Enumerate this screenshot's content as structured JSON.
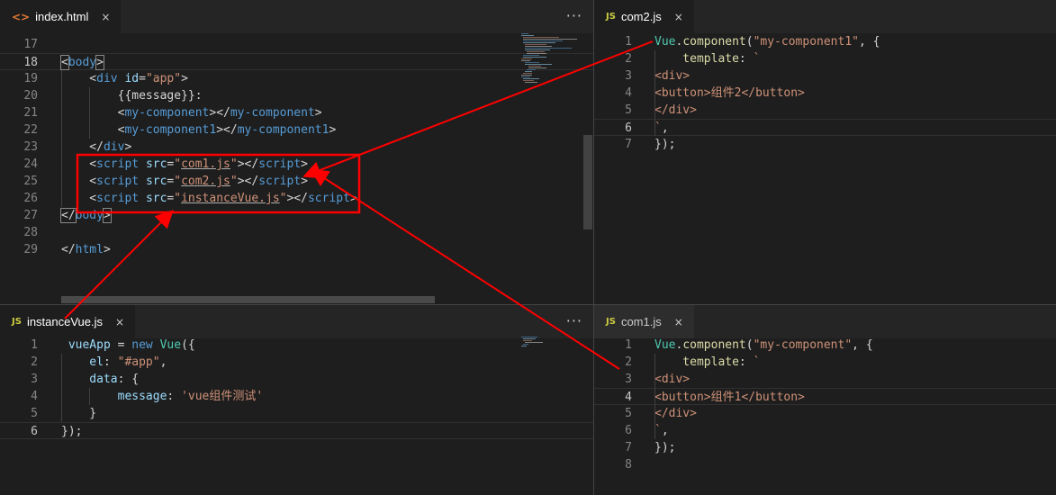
{
  "colors": {
    "annotation": "#ff0000",
    "editor_bg": "#1e1e1e",
    "tabbar_bg": "#252526"
  },
  "panes": {
    "index_html": {
      "tab": {
        "icon": "<>",
        "icon_name": "html-file-icon",
        "title": "index.html",
        "close": "×"
      },
      "more": "···",
      "lines": [
        {
          "n": "17",
          "tokens": []
        },
        {
          "n": "18",
          "tokens": [
            [
              "t-pun bracket",
              "<"
            ],
            [
              "t-tag",
              "body"
            ],
            [
              "t-pun bracket",
              ">"
            ]
          ]
        },
        {
          "n": "19",
          "tokens": [
            [
              "t-pun",
              "    <"
            ],
            [
              "t-tag",
              "div"
            ],
            [
              "t-pun",
              " "
            ],
            [
              "t-attr",
              "id"
            ],
            [
              "t-pun",
              "="
            ],
            [
              "t-str",
              "\"app\""
            ],
            [
              "t-pun",
              ">"
            ]
          ]
        },
        {
          "n": "20",
          "tokens": [
            [
              "t-text",
              "        {{message}}:"
            ]
          ]
        },
        {
          "n": "21",
          "tokens": [
            [
              "t-pun",
              "        <"
            ],
            [
              "t-tag",
              "my-component"
            ],
            [
              "t-pun",
              "></"
            ],
            [
              "t-tag",
              "my-component"
            ],
            [
              "t-pun",
              ">"
            ]
          ]
        },
        {
          "n": "22",
          "tokens": [
            [
              "t-pun",
              "        <"
            ],
            [
              "t-tag",
              "my-component1"
            ],
            [
              "t-pun",
              "></"
            ],
            [
              "t-tag",
              "my-component1"
            ],
            [
              "t-pun",
              ">"
            ]
          ]
        },
        {
          "n": "23",
          "tokens": [
            [
              "t-pun",
              "    </"
            ],
            [
              "t-tag",
              "div"
            ],
            [
              "t-pun",
              ">"
            ]
          ]
        },
        {
          "n": "24",
          "tokens": [
            [
              "t-pun",
              "    <"
            ],
            [
              "t-tag",
              "script"
            ],
            [
              "t-pun",
              " "
            ],
            [
              "t-attr",
              "src"
            ],
            [
              "t-pun",
              "="
            ],
            [
              "t-str",
              "\""
            ],
            [
              "t-str u",
              "com1.js"
            ],
            [
              "t-str",
              "\""
            ],
            [
              "t-pun",
              "></"
            ],
            [
              "t-tag",
              "script"
            ],
            [
              "t-pun",
              ">"
            ]
          ]
        },
        {
          "n": "25",
          "tokens": [
            [
              "t-pun",
              "    <"
            ],
            [
              "t-tag",
              "script"
            ],
            [
              "t-pun",
              " "
            ],
            [
              "t-attr",
              "src"
            ],
            [
              "t-pun",
              "="
            ],
            [
              "t-str",
              "\""
            ],
            [
              "t-str u",
              "com2.js"
            ],
            [
              "t-str",
              "\""
            ],
            [
              "t-pun",
              "></"
            ],
            [
              "t-tag",
              "script"
            ],
            [
              "t-pun",
              ">"
            ]
          ]
        },
        {
          "n": "26",
          "tokens": [
            [
              "t-pun",
              "    <"
            ],
            [
              "t-tag",
              "script"
            ],
            [
              "t-pun",
              " "
            ],
            [
              "t-attr",
              "src"
            ],
            [
              "t-pun",
              "="
            ],
            [
              "t-str",
              "\""
            ],
            [
              "t-str u",
              "instanceVue.js"
            ],
            [
              "t-str",
              "\""
            ],
            [
              "t-pun",
              "></"
            ],
            [
              "t-tag",
              "script"
            ],
            [
              "t-pun",
              ">"
            ]
          ]
        },
        {
          "n": "27",
          "tokens": [
            [
              "t-pun bracket",
              "</"
            ],
            [
              "t-tag",
              "body"
            ],
            [
              "t-pun bracket",
              ">"
            ]
          ]
        },
        {
          "n": "28",
          "tokens": []
        },
        {
          "n": "29",
          "tokens": [
            [
              "t-pun",
              "</"
            ],
            [
              "t-tag",
              "html"
            ],
            [
              "t-pun",
              ">"
            ]
          ]
        }
      ]
    },
    "com2_js": {
      "tab": {
        "icon": "JS",
        "icon_name": "js-file-icon",
        "title": "com2.js",
        "close": "×"
      },
      "lines": [
        {
          "n": "1",
          "tokens": [
            [
              "t-cls",
              "Vue"
            ],
            [
              "t-pun",
              "."
            ],
            [
              "t-fn",
              "component"
            ],
            [
              "t-pun",
              "("
            ],
            [
              "t-str",
              "\"my-component1\""
            ],
            [
              "t-pun",
              ", {"
            ]
          ]
        },
        {
          "n": "2",
          "tokens": [
            [
              "t-fn",
              "    template"
            ],
            [
              "t-pun",
              ": "
            ],
            [
              "t-str",
              "`"
            ]
          ]
        },
        {
          "n": "3",
          "tokens": [
            [
              "t-str",
              "<div>"
            ]
          ]
        },
        {
          "n": "4",
          "tokens": [
            [
              "t-str",
              "<button>组件2</button>"
            ]
          ]
        },
        {
          "n": "5",
          "tokens": [
            [
              "t-str",
              "</div>"
            ]
          ]
        },
        {
          "n": "6",
          "tokens": [
            [
              "t-str",
              "`"
            ],
            [
              "t-pun",
              ","
            ]
          ]
        },
        {
          "n": "7",
          "tokens": [
            [
              "t-pun",
              "});"
            ]
          ]
        }
      ]
    },
    "instanceVue_js": {
      "tab": {
        "icon": "JS",
        "icon_name": "js-file-icon",
        "title": "instanceVue.js",
        "close": "×"
      },
      "more": "···",
      "lines": [
        {
          "n": "1",
          "tokens": [
            [
              "t-prop",
              " vueApp"
            ],
            [
              "t-pun",
              " = "
            ],
            [
              "t-kw",
              "new"
            ],
            [
              "t-pun",
              " "
            ],
            [
              "t-cls",
              "Vue"
            ],
            [
              "t-pun",
              "({"
            ]
          ]
        },
        {
          "n": "2",
          "tokens": [
            [
              "t-prop",
              "    el"
            ],
            [
              "t-pun",
              ": "
            ],
            [
              "t-str",
              "\"#app\""
            ],
            [
              "t-pun",
              ","
            ]
          ]
        },
        {
          "n": "3",
          "tokens": [
            [
              "t-prop",
              "    data"
            ],
            [
              "t-pun",
              ": {"
            ]
          ]
        },
        {
          "n": "4",
          "tokens": [
            [
              "t-prop",
              "        message"
            ],
            [
              "t-pun",
              ": "
            ],
            [
              "t-str",
              "'vue组件测试'"
            ]
          ]
        },
        {
          "n": "5",
          "tokens": [
            [
              "t-pun",
              "    }"
            ]
          ]
        },
        {
          "n": "6",
          "tokens": [
            [
              "t-pun",
              "});"
            ]
          ]
        }
      ]
    },
    "com1_js": {
      "tab": {
        "icon": "JS",
        "icon_name": "js-file-icon",
        "title": "com1.js",
        "close": "×"
      },
      "lines": [
        {
          "n": "1",
          "tokens": [
            [
              "t-cls",
              "Vue"
            ],
            [
              "t-pun",
              "."
            ],
            [
              "t-fn",
              "component"
            ],
            [
              "t-pun",
              "("
            ],
            [
              "t-str",
              "\"my-component\""
            ],
            [
              "t-pun",
              ", {"
            ]
          ]
        },
        {
          "n": "2",
          "tokens": [
            [
              "t-fn",
              "    template"
            ],
            [
              "t-pun",
              ": "
            ],
            [
              "t-str",
              "`"
            ]
          ]
        },
        {
          "n": "3",
          "tokens": [
            [
              "t-str",
              "<div>"
            ]
          ]
        },
        {
          "n": "4",
          "tokens": [
            [
              "t-str",
              "<button>组件1</button>"
            ]
          ]
        },
        {
          "n": "5",
          "tokens": [
            [
              "t-str",
              "</div>"
            ]
          ]
        },
        {
          "n": "6",
          "tokens": [
            [
              "t-str",
              "`"
            ],
            [
              "t-pun",
              ","
            ]
          ]
        },
        {
          "n": "7",
          "tokens": [
            [
              "t-pun",
              "});"
            ]
          ]
        },
        {
          "n": "8",
          "tokens": []
        }
      ]
    }
  }
}
